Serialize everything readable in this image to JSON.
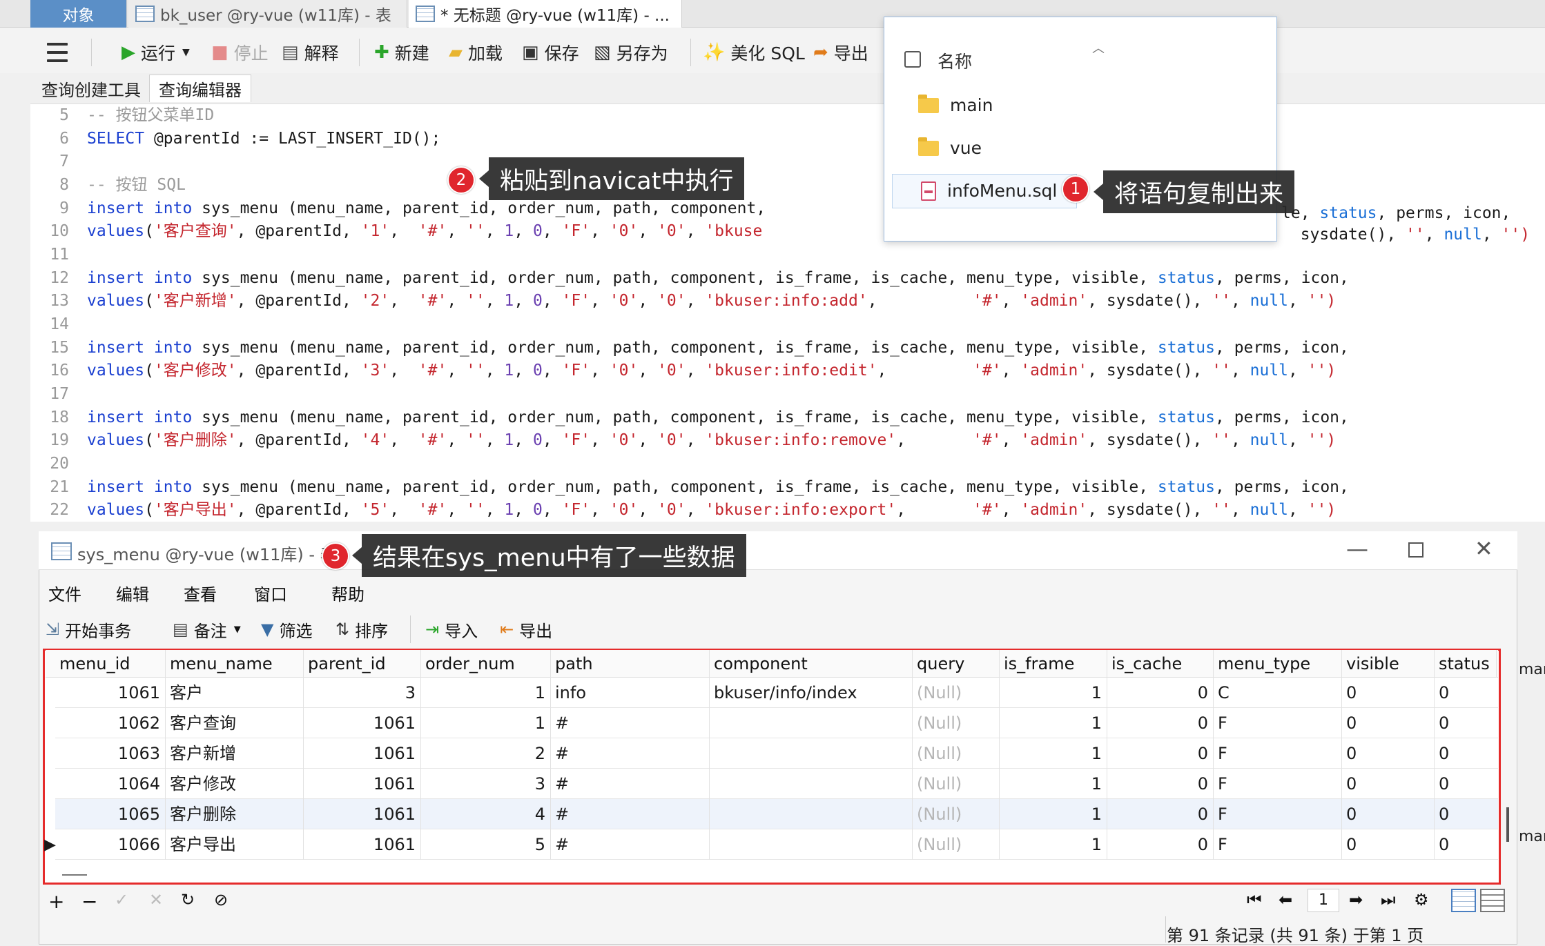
{
  "tabs": {
    "objects": "对象",
    "bk_user": "bk_user @ry-vue (w11库) - 表",
    "untitled": "* 无标题 @ry-vue (w11库) - ..."
  },
  "toolbar": {
    "run": "运行",
    "stop": "停止",
    "explain": "解释",
    "new": "新建",
    "load": "加载",
    "save": "保存",
    "save_as": "另存为",
    "beautify": "美化 SQL",
    "export": "导出"
  },
  "subtabs": [
    "查询创建工具",
    "查询编辑器"
  ],
  "editor": {
    "lines": [
      {
        "n": "5",
        "parts": [
          [
            "cm",
            "-- 按钮父菜单ID"
          ]
        ]
      },
      {
        "n": "6",
        "parts": [
          [
            "kw",
            "SELECT"
          ],
          [
            "",
            " @parentId := LAST_INSERT_ID();"
          ]
        ]
      },
      {
        "n": "7",
        "parts": []
      },
      {
        "n": "8",
        "parts": [
          [
            "cm",
            "-- 按钮 SQL"
          ]
        ]
      },
      {
        "n": "9",
        "parts": [
          [
            "kw",
            "insert into"
          ],
          [
            "",
            " sys_menu (menu_name, parent_id, order_num, path, component, "
          ]
        ]
      },
      {
        "n": "10",
        "parts": [
          [
            "kw",
            "values"
          ],
          [
            "",
            "("
          ],
          [
            "st",
            "'客户查询'"
          ],
          [
            "",
            ", @parentId, "
          ],
          [
            "st",
            "'1'"
          ],
          [
            "",
            ",  "
          ],
          [
            "st",
            "'#'"
          ],
          [
            "",
            ", "
          ],
          [
            "st",
            "''"
          ],
          [
            "",
            ", "
          ],
          [
            "cn",
            "1"
          ],
          [
            "",
            ", "
          ],
          [
            "cn",
            "0"
          ],
          [
            "",
            ", "
          ],
          [
            "st",
            "'F'"
          ],
          [
            "",
            ", "
          ],
          [
            "st",
            "'0'"
          ],
          [
            "",
            ", "
          ],
          [
            "st",
            "'0'"
          ],
          [
            "",
            ", "
          ],
          [
            "st",
            "'bkuse"
          ]
        ]
      },
      {
        "n": "11",
        "parts": []
      },
      {
        "n": "12",
        "parts": [
          [
            "kw",
            "insert into"
          ],
          [
            "",
            " sys_menu (menu_name, parent_id, order_num, path, component, is_frame, is_cache, menu_type, visible, "
          ],
          [
            "kw2",
            "status"
          ],
          [
            "",
            ", perms, icon,"
          ]
        ]
      },
      {
        "n": "13",
        "parts": [
          [
            "kw",
            "values"
          ],
          [
            "",
            "("
          ],
          [
            "st",
            "'客户新增'"
          ],
          [
            "",
            ", @parentId, "
          ],
          [
            "st",
            "'2'"
          ],
          [
            "",
            ",  "
          ],
          [
            "st",
            "'#'"
          ],
          [
            "",
            ", "
          ],
          [
            "st",
            "''"
          ],
          [
            "",
            ", "
          ],
          [
            "cn",
            "1"
          ],
          [
            "",
            ", "
          ],
          [
            "cn",
            "0"
          ],
          [
            "",
            ", "
          ],
          [
            "st",
            "'F'"
          ],
          [
            "",
            ", "
          ],
          [
            "st",
            "'0'"
          ],
          [
            "",
            ", "
          ],
          [
            "st",
            "'0'"
          ],
          [
            "",
            ", "
          ],
          [
            "st",
            "'bkuser:info:add'"
          ],
          [
            "",
            ",          "
          ],
          [
            "st",
            "'#'"
          ],
          [
            "",
            ", "
          ],
          [
            "st",
            "'admin'"
          ],
          [
            "",
            ", sysdate(), "
          ],
          [
            "st",
            "''"
          ],
          [
            "",
            ", "
          ],
          [
            "kw2",
            "null"
          ],
          [
            "",
            ", "
          ],
          [
            "st",
            "'')"
          ]
        ]
      },
      {
        "n": "14",
        "parts": []
      },
      {
        "n": "15",
        "parts": [
          [
            "kw",
            "insert into"
          ],
          [
            "",
            " sys_menu (menu_name, parent_id, order_num, path, component, is_frame, is_cache, menu_type, visible, "
          ],
          [
            "kw2",
            "status"
          ],
          [
            "",
            ", perms, icon,"
          ]
        ]
      },
      {
        "n": "16",
        "parts": [
          [
            "kw",
            "values"
          ],
          [
            "",
            "("
          ],
          [
            "st",
            "'客户修改'"
          ],
          [
            "",
            ", @parentId, "
          ],
          [
            "st",
            "'3'"
          ],
          [
            "",
            ",  "
          ],
          [
            "st",
            "'#'"
          ],
          [
            "",
            ", "
          ],
          [
            "st",
            "''"
          ],
          [
            "",
            ", "
          ],
          [
            "cn",
            "1"
          ],
          [
            "",
            ", "
          ],
          [
            "cn",
            "0"
          ],
          [
            "",
            ", "
          ],
          [
            "st",
            "'F'"
          ],
          [
            "",
            ", "
          ],
          [
            "st",
            "'0'"
          ],
          [
            "",
            ", "
          ],
          [
            "st",
            "'0'"
          ],
          [
            "",
            ", "
          ],
          [
            "st",
            "'bkuser:info:edit'"
          ],
          [
            "",
            ",         "
          ],
          [
            "st",
            "'#'"
          ],
          [
            "",
            ", "
          ],
          [
            "st",
            "'admin'"
          ],
          [
            "",
            ", sysdate(), "
          ],
          [
            "st",
            "''"
          ],
          [
            "",
            ", "
          ],
          [
            "kw2",
            "null"
          ],
          [
            "",
            ", "
          ],
          [
            "st",
            "'')"
          ]
        ]
      },
      {
        "n": "17",
        "parts": []
      },
      {
        "n": "18",
        "parts": [
          [
            "kw",
            "insert into"
          ],
          [
            "",
            " sys_menu (menu_name, parent_id, order_num, path, component, is_frame, is_cache, menu_type, visible, "
          ],
          [
            "kw2",
            "status"
          ],
          [
            "",
            ", perms, icon,"
          ]
        ]
      },
      {
        "n": "19",
        "parts": [
          [
            "kw",
            "values"
          ],
          [
            "",
            "("
          ],
          [
            "st",
            "'客户删除'"
          ],
          [
            "",
            ", @parentId, "
          ],
          [
            "st",
            "'4'"
          ],
          [
            "",
            ",  "
          ],
          [
            "st",
            "'#'"
          ],
          [
            "",
            ", "
          ],
          [
            "st",
            "''"
          ],
          [
            "",
            ", "
          ],
          [
            "cn",
            "1"
          ],
          [
            "",
            ", "
          ],
          [
            "cn",
            "0"
          ],
          [
            "",
            ", "
          ],
          [
            "st",
            "'F'"
          ],
          [
            "",
            ", "
          ],
          [
            "st",
            "'0'"
          ],
          [
            "",
            ", "
          ],
          [
            "st",
            "'0'"
          ],
          [
            "",
            ", "
          ],
          [
            "st",
            "'bkuser:info:remove'"
          ],
          [
            "",
            ",       "
          ],
          [
            "st",
            "'#'"
          ],
          [
            "",
            ", "
          ],
          [
            "st",
            "'admin'"
          ],
          [
            "",
            ", sysdate(), "
          ],
          [
            "st",
            "''"
          ],
          [
            "",
            ", "
          ],
          [
            "kw2",
            "null"
          ],
          [
            "",
            ", "
          ],
          [
            "st",
            "'')"
          ]
        ]
      },
      {
        "n": "20",
        "parts": []
      },
      {
        "n": "21",
        "parts": [
          [
            "kw",
            "insert into"
          ],
          [
            "",
            " sys_menu (menu_name, parent_id, order_num, path, component, is_frame, is_cache, menu_type, visible, "
          ],
          [
            "kw2",
            "status"
          ],
          [
            "",
            ", perms, icon,"
          ]
        ]
      },
      {
        "n": "22",
        "parts": [
          [
            "kw",
            "values"
          ],
          [
            "",
            "("
          ],
          [
            "st",
            "'客户导出'"
          ],
          [
            "",
            ", @parentId, "
          ],
          [
            "st",
            "'5'"
          ],
          [
            "",
            ",  "
          ],
          [
            "st",
            "'#'"
          ],
          [
            "",
            ", "
          ],
          [
            "st",
            "''"
          ],
          [
            "",
            ", "
          ],
          [
            "cn",
            "1"
          ],
          [
            "",
            ", "
          ],
          [
            "cn",
            "0"
          ],
          [
            "",
            ", "
          ],
          [
            "st",
            "'F'"
          ],
          [
            "",
            ", "
          ],
          [
            "st",
            "'0'"
          ],
          [
            "",
            ", "
          ],
          [
            "st",
            "'0'"
          ],
          [
            "",
            ", "
          ],
          [
            "st",
            "'bkuser:info:export'"
          ],
          [
            "",
            ",       "
          ],
          [
            "st",
            "'#'"
          ],
          [
            "",
            ", "
          ],
          [
            "st",
            "'admin'"
          ],
          [
            "",
            ", sysdate(), "
          ],
          [
            "st",
            "''"
          ],
          [
            "",
            ", "
          ],
          [
            "kw2",
            "null"
          ],
          [
            "",
            ", "
          ],
          [
            "st",
            "'')"
          ]
        ]
      }
    ],
    "line9_tail": [
      "le",
      ", ",
      "status",
      ", perms, icon,"
    ],
    "line10_tail": [
      "sysdate(), ",
      "''",
      ", ",
      "null",
      ", ",
      "'')"
    ]
  },
  "popup": {
    "header": "名称",
    "items": [
      {
        "type": "folder",
        "name": "main"
      },
      {
        "type": "folder",
        "name": "vue"
      },
      {
        "type": "sql",
        "name": "infoMenu.sql"
      }
    ]
  },
  "callouts": [
    {
      "n": "1",
      "text": "将语句复制出来"
    },
    {
      "n": "2",
      "text": "粘贴到navicat中执行"
    },
    {
      "n": "3",
      "text": "结果在sys_menu中有了一些数据"
    }
  ],
  "result_window": {
    "title": "sys_menu @ry-vue (w11库) - 表",
    "menu": [
      "文件",
      "编辑",
      "查看",
      "窗口",
      "帮助"
    ],
    "toolbar": [
      "开始事务",
      "备注",
      "筛选",
      "排序",
      "导入",
      "导出"
    ],
    "columns": [
      "menu_id",
      "menu_name",
      "parent_id",
      "order_num",
      "path",
      "component",
      "query",
      "is_frame",
      "is_cache",
      "menu_type",
      "visible",
      "status"
    ],
    "rows": [
      [
        "1061",
        "客户",
        "3",
        "1",
        "info",
        "bkuser/info/index",
        "(Null)",
        "1",
        "0",
        "C",
        "0",
        "0"
      ],
      [
        "1062",
        "客户查询",
        "1061",
        "1",
        "#",
        "",
        "(Null)",
        "1",
        "0",
        "F",
        "0",
        "0"
      ],
      [
        "1063",
        "客户新增",
        "1061",
        "2",
        "#",
        "",
        "(Null)",
        "1",
        "0",
        "F",
        "0",
        "0"
      ],
      [
        "1064",
        "客户修改",
        "1061",
        "3",
        "#",
        "",
        "(Null)",
        "1",
        "0",
        "F",
        "0",
        "0"
      ],
      [
        "1065",
        "客户删除",
        "1061",
        "4",
        "#",
        "",
        "(Null)",
        "1",
        "0",
        "F",
        "0",
        "0"
      ],
      [
        "1066",
        "客户导出",
        "1061",
        "5",
        "#",
        "",
        "(Null)",
        "1",
        "0",
        "F",
        "0",
        "0"
      ]
    ],
    "page_number": "1",
    "status": "第 91 条记录 (共 91 条) 于第 1 页",
    "right_edge_text": "mar"
  }
}
